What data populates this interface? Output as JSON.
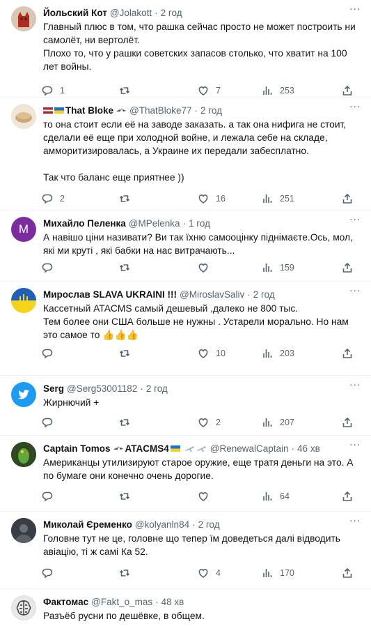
{
  "tweets": [
    {
      "name": "Йольский Кот",
      "handle": "@Jolakott",
      "time": "2 год",
      "lines": [
        "Главный плюс в том, что рашка сейчас просто не может построить ни самолёт, ни вертолёт.",
        "Плохо то, что у рашки советских запасов столько, что хватит на 100 лет войны."
      ],
      "replies": "1",
      "retweets": "",
      "likes": "7",
      "views": "253",
      "avatar_color": "#b02b1e"
    },
    {
      "name": "That Bloke",
      "handle": "@ThatBloke77",
      "time": "2 год",
      "lines": [
        "то она стоит если её на заводе заказать. а так она нифига не стоит, сделали её еще при холодной войне, и лежала себе на складе, амморитизировалась, а Украине их передали забесплатно.",
        "Так что баланс еще приятнее ))"
      ],
      "replies": "2",
      "retweets": "",
      "likes": "16",
      "views": "251",
      "avatar_color": "#c9a77a"
    },
    {
      "name": "Михайло Пеленка",
      "handle": "@MPelenka",
      "time": "1 год",
      "lines": [
        "А навішо ціни називати? Ви так їхню самооцінку піднімаєте.Ось, мол, які ми круті , які бабки на нас витрачають..."
      ],
      "replies": "",
      "retweets": "",
      "likes": "",
      "views": "159",
      "avatar_letter": "M",
      "avatar_color": "#7b2d9e"
    },
    {
      "name": "Мирослав SLAVA UKRAINI !!!",
      "handle": "@MiroslavSaliv",
      "time": "2 год",
      "lines": [
        "Кассетный ATACMS самый дешевый ,далеко  не 800 тыс.",
        "Тем более они США больше не нужны . Устарели морально. Но нам это самое то 👍👍👍"
      ],
      "replies": "",
      "retweets": "",
      "likes": "10",
      "views": "203",
      "avatar_color": "#1f5fb8"
    },
    {
      "name": "Serg",
      "handle": "@Serg53001182",
      "time": "2 год",
      "lines": [
        "Жирнючий +"
      ],
      "replies": "",
      "retweets": "",
      "likes": "2",
      "views": "207",
      "avatar_color": "#1d9bf0"
    },
    {
      "name": "Captain Tomos",
      "name_suffix": "ATACMS4",
      "handle": "@RenewalCaptain",
      "time": "46 хв",
      "lines": [
        "Американцы утилизируют старое оружие, еще тратя деньги на это. А по бумаге они конечно очень дорогие."
      ],
      "replies": "",
      "retweets": "",
      "likes": "",
      "views": "64",
      "avatar_color": "#3c6b2a"
    },
    {
      "name": "Миколай Єременко",
      "handle": "@kolyanln84",
      "time": "2 год",
      "lines": [
        "Головне тут не це, головне що тепер їм доведеться далі відводить авіацію, ті ж самі Ка 52."
      ],
      "replies": "",
      "retweets": "",
      "likes": "4",
      "views": "170",
      "avatar_color": "#4a4f55"
    },
    {
      "name": "Фактомас",
      "handle": "@Fakt_o_mas",
      "time": "48 хв",
      "lines": [
        "Разъёб русни по дешёвке, в общем."
      ],
      "replies": "",
      "retweets": "",
      "likes": "",
      "views": "",
      "avatar_color": "#e8e8e8"
    }
  ],
  "dot": "·",
  "more_glyph": "···"
}
